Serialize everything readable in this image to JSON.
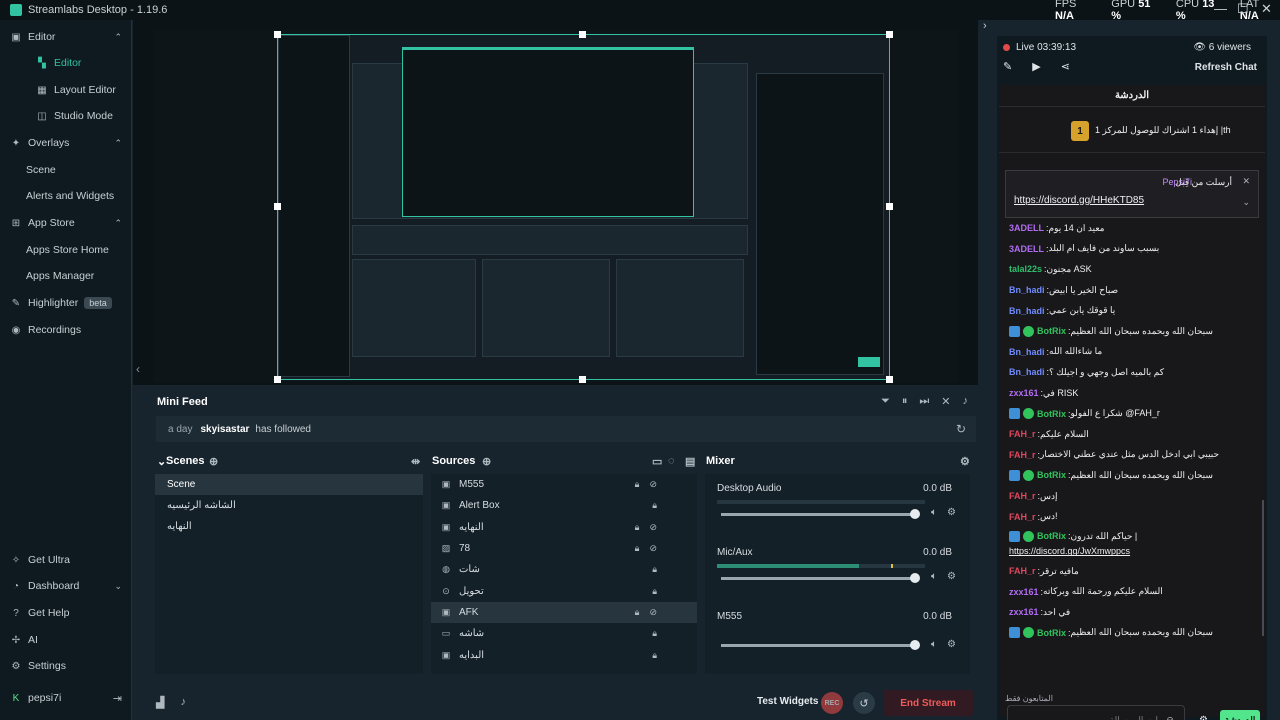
{
  "window": {
    "title": "Streamlabs Desktop - 1.19.6",
    "minimize": "—",
    "maximize": "☐",
    "close": "✕"
  },
  "stats": [
    {
      "label": "FPS",
      "value": "N/A"
    },
    {
      "label": "GPU",
      "value": "51 %"
    },
    {
      "label": "CPU",
      "value": "13 %"
    },
    {
      "label": "LAT",
      "value": "N/A"
    }
  ],
  "sidebar": {
    "editor": "Editor",
    "editor_sub": "Editor",
    "layout_editor": "Layout Editor",
    "studio_mode": "Studio Mode",
    "overlays": "Overlays",
    "scene": "Scene",
    "alerts_widgets": "Alerts and Widgets",
    "app_store": "App Store",
    "apps_store_home": "Apps Store Home",
    "apps_manager": "Apps Manager",
    "highlighter": "Highlighter",
    "beta": "beta",
    "recordings": "Recordings",
    "get_ultra": "Get Ultra",
    "dashboard": "Dashboard",
    "get_help": "Get Help",
    "ai": "AI",
    "settings": "Settings",
    "user": "pepsi7i"
  },
  "minifeed": {
    "title": "Mini Feed",
    "time": "a day",
    "user": "skyisastar",
    "action": "has followed"
  },
  "scenes": {
    "title": "Scenes",
    "items": [
      "Scene",
      "الشاشه الرئيسيه",
      "النهايه"
    ]
  },
  "sources": {
    "title": "Sources",
    "items": [
      "M555",
      "Alert Box",
      "النهايه",
      "78",
      "شات",
      "تحويل",
      "AFK",
      "شاشه",
      "البدايه"
    ]
  },
  "mixer": {
    "title": "Mixer",
    "items": [
      {
        "name": "Desktop Audio",
        "db": "0.0 dB"
      },
      {
        "name": "Mic/Aux",
        "db": "0.0 dB"
      },
      {
        "name": "M555",
        "db": "0.0 dB"
      }
    ]
  },
  "bottom": {
    "test_widgets": "Test Widgets",
    "rec": "REC",
    "end_stream": "End Stream"
  },
  "chat": {
    "live": "Live 03:39:13",
    "viewers": "6 viewers",
    "refresh": "Refresh Chat",
    "title": "الدردشة",
    "goal_num": "1",
    "goal_text": "إهداء 1 اشتراك للوصول للمركز 1 |th",
    "pinned_by": "أرسلت من قِبل",
    "pinned_user": "Pepsi7i",
    "pinned_link": "https://discord.gg/HHeKTD85",
    "messages": [
      {
        "user": "3ADELL",
        "color": "#b06cf0",
        "text": "معيد ان 14 يوم"
      },
      {
        "user": "3ADELL",
        "color": "#b06cf0",
        "text": "بسبب ساوند من فايف ام البلد"
      },
      {
        "user": "talal22s",
        "color": "#2fbf6c",
        "text": "مجنون ASK"
      },
      {
        "user": "Bn_hadi",
        "color": "#6f8cff",
        "text": "صباح الخير يا ابيض"
      },
      {
        "user": "Bn_hadi",
        "color": "#6f8cff",
        "text": "يا قوقك يابن عمي"
      },
      {
        "user": "BotRix",
        "color": "#31c35c",
        "text": "سبحان الله وبحمده سبحان الله العظيم",
        "badges": true
      },
      {
        "user": "Bn_hadi",
        "color": "#6f8cff",
        "text": "ما شاءالله الله"
      },
      {
        "user": "Bn_hadi",
        "color": "#6f8cff",
        "text": "كم بالميه اصل وجهي و اجيلك ؟"
      },
      {
        "user": "zxx161",
        "color": "#b06cf0",
        "text": "في RISK"
      },
      {
        "user": "BotRix",
        "color": "#31c35c",
        "text": "شكرا ع الفولو @FAH_r",
        "badges": true
      },
      {
        "user": "FAH_r",
        "color": "#e0465d",
        "text": "السلام عليكم"
      },
      {
        "user": "FAH_r",
        "color": "#e0465d",
        "text": "حبيبي ابي ادخل الدس مثل عندي عطني الاختصار"
      },
      {
        "user": "BotRix",
        "color": "#31c35c",
        "text": "سبحان الله وبحمده سبحان الله العظيم",
        "badges": true
      },
      {
        "user": "FAH_r",
        "color": "#e0465d",
        "text": "إدس"
      },
      {
        "user": "FAH_r",
        "color": "#e0465d",
        "text": "دس!"
      },
      {
        "user": "BotRix",
        "color": "#31c35c",
        "text": "حياكم الله تدرون |",
        "link": "https://discord.gg/JwXmwppcs",
        "badges": true
      },
      {
        "user": "FAH_r",
        "color": "#e0465d",
        "text": "مافيه ترقر"
      },
      {
        "user": "zxx161",
        "color": "#b06cf0",
        "text": "السلام عليكم ورحمة الله وبركاته"
      },
      {
        "user": "zxx161",
        "color": "#b06cf0",
        "text": "في احد"
      },
      {
        "user": "BotRix",
        "color": "#31c35c",
        "text": "سبحان الله وبحمده سبحان الله العظيم",
        "badges": true
      }
    ],
    "footer": "المتابعون فقط",
    "input_placeholder": "إرسال رسالة",
    "send": "الدردشة"
  }
}
